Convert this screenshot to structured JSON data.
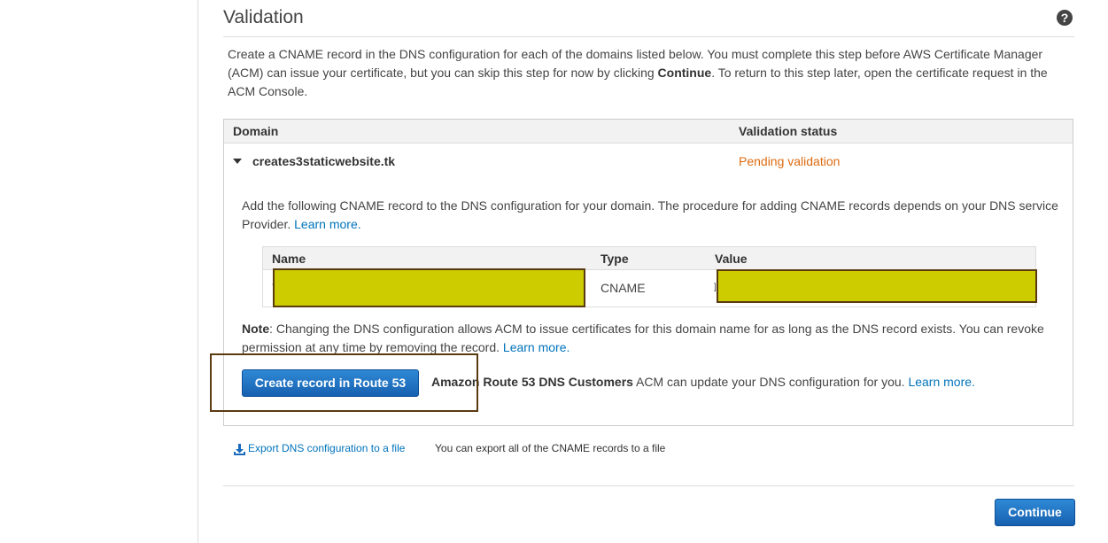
{
  "page": {
    "title": "Validation",
    "help_icon": "question-circle-icon",
    "intro_part1": "Create a CNAME record in the DNS configuration for each of the domains listed below. You must complete this step before AWS Certificate Manager (ACM) can issue your certificate, but you can skip this step for now by clicking ",
    "intro_bold": "Continue",
    "intro_part2": ". To return to this step later, open the certificate request in the ACM Console."
  },
  "domains_table": {
    "headers": [
      "Domain",
      "Validation status"
    ],
    "rows": [
      {
        "domain": "creates3staticwebsite.tk",
        "status": "Pending validation",
        "status_color": "#dd6b10",
        "add_text": "Add the following CNAME record to the DNS configuration for your domain. The procedure for adding CNAME records depends on your DNS service Provider. ",
        "add_link": "Learn more.",
        "record_headers": [
          "Name",
          "Type",
          "Value"
        ],
        "record": {
          "name": "",
          "type": "CNAME",
          "value": ""
        },
        "note_label": "Note",
        "note_text": ": Changing the DNS configuration allows ACM to issue certificates for this domain name for as long as the DNS record exists. You can revoke permission at any time by removing the record. ",
        "note_link": "Learn more.",
        "route53_button": "Create record in Route 53",
        "route53_bold": "Amazon Route 53 DNS Customers",
        "route53_text": " ACM can update your DNS configuration for you. ",
        "route53_link": "Learn more."
      }
    ]
  },
  "export": {
    "icon": "download-icon",
    "link": "Export DNS configuration to a file",
    "desc": "You can export all of the CNAME records to a file"
  },
  "footer": {
    "continue_label": "Continue"
  },
  "colors": {
    "link": "#0073bb",
    "button": "#1a6bbd",
    "redaction": "#cccc00",
    "pending": "#dd6b10"
  }
}
